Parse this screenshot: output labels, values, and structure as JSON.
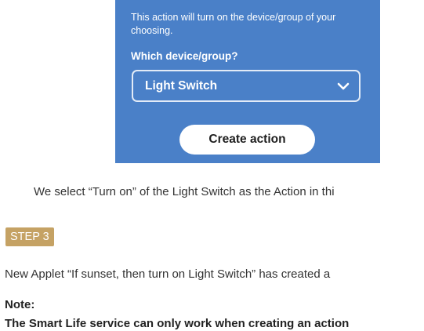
{
  "action_panel": {
    "description": "This action will turn on the device/group of your choosing.",
    "question": "Which device/group?",
    "selected_device": "Light Switch",
    "dropdown_icon": "chevron-down-icon",
    "create_button_label": "Create action",
    "background_color": "#4a80c8"
  },
  "caption": "We select “Turn on” of the Light Switch as the Action in thi",
  "step": {
    "badge_label": "STEP 3",
    "badge_color": "#c5a264",
    "text": "New Applet “If sunset, then turn on Light Switch” has created a"
  },
  "note": {
    "label": "Note:",
    "body": "The Smart Life service can only work when creating an action"
  }
}
